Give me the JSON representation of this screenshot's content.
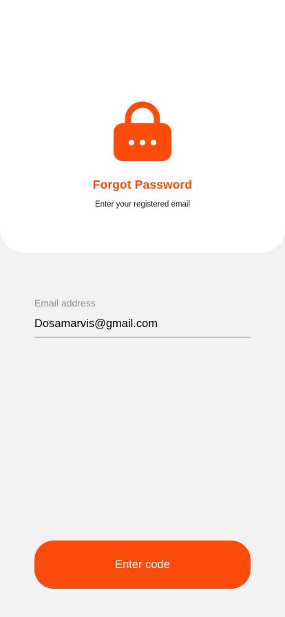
{
  "header": {
    "title": "Forgot Password",
    "subtitle": "Enter your registered email",
    "icon": "lock-icon",
    "accent_color": "#fc4c0c"
  },
  "form": {
    "email_label": "Email address",
    "email_value": "Dosamarvis@gmail.com"
  },
  "actions": {
    "submit_label": "Enter code"
  }
}
